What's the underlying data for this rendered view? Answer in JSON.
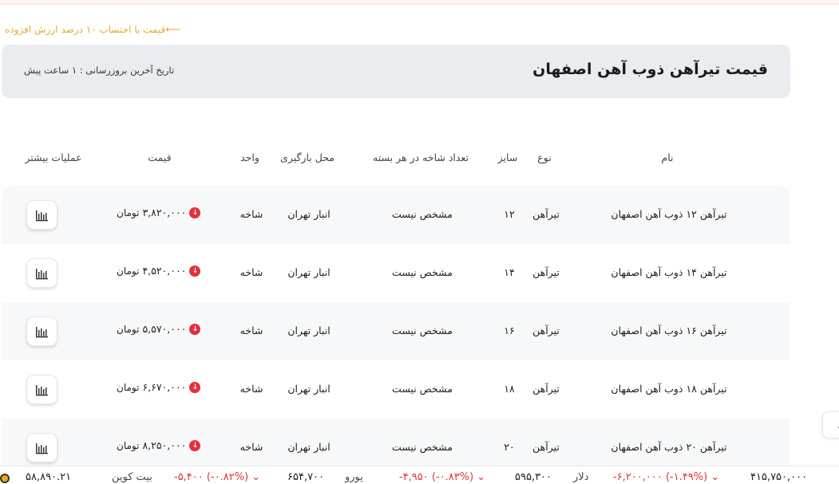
{
  "vat_link": {
    "label": "قیمت با احتساب ۱۰ درصد ارزش افزوده",
    "arrow": "⟵"
  },
  "header": {
    "title": "قیمت تیرآهن ذوب آهن اصفهان",
    "update": "تاریخ آخرین بروزرسانی : ۱ ساعت پیش"
  },
  "table": {
    "columns": {
      "name": "نام",
      "type": "نوع",
      "size": "سایز",
      "count": "تعداد شاخه در هر بسته",
      "location": "محل بارگیری",
      "unit": "واحد",
      "price": "قیمت",
      "more": "عملیات بیشتر"
    },
    "rows": [
      {
        "name": "تیرآهن ۱۲ ذوب آهن اصفهان",
        "type": "تیرآهن",
        "size": "۱۲",
        "count": "مشخص نیست",
        "location": "انبار تهران",
        "unit": "شاخه",
        "price": "۳,۸۲۰,۰۰۰",
        "currency": "تومان"
      },
      {
        "name": "تیرآهن ۱۴ ذوب آهن اصفهان",
        "type": "تیرآهن",
        "size": "۱۴",
        "count": "مشخص نیست",
        "location": "انبار تهران",
        "unit": "شاخه",
        "price": "۴,۵۲۰,۰۰۰",
        "currency": "تومان"
      },
      {
        "name": "تیرآهن ۱۶ ذوب آهن اصفهان",
        "type": "تیرآهن",
        "size": "۱۶",
        "count": "مشخص نیست",
        "location": "انبار تهران",
        "unit": "شاخه",
        "price": "۵,۵۷۰,۰۰۰",
        "currency": "تومان"
      },
      {
        "name": "تیرآهن ۱۸ ذوب آهن اصفهان",
        "type": "تیرآهن",
        "size": "۱۸",
        "count": "مشخص نیست",
        "location": "انبار تهران",
        "unit": "شاخه",
        "price": "۶,۶۷۰,۰۰۰",
        "currency": "تومان"
      },
      {
        "name": "تیرآهن ۲۰ ذوب آهن اصفهان",
        "type": "تیرآهن",
        "size": "۲۰",
        "count": "مشخص نیست",
        "location": "انبار تهران",
        "unit": "شاخه",
        "price": "۸,۲۵۰,۰۰۰",
        "currency": "تومان"
      }
    ]
  },
  "ticker": {
    "items": [
      {
        "value": "۴۱۵,۷۵۰,۰۰۰",
        "change": "-۶,۲۰۰,۰۰۰ (-۱.۴۹%) ⌄"
      },
      {
        "name": "دلار",
        "value": "۵۹۵,۳۰۰",
        "change": "-۴,۹۵۰ (-۰.۸۳%) ⌄"
      },
      {
        "name": "یورو",
        "value": "۶۵۴,۷۰۰",
        "change": "-۵,۴۰۰ (-۰.۸۲%) ⌄"
      },
      {
        "name": "بیت کوین",
        "value": "۵۸,۸۹۰.۲۱"
      }
    ]
  },
  "side_tab": {
    "label": "ی"
  },
  "colors": {
    "accent": "#e8a93a",
    "negative": "#e5303b",
    "header_bg": "#e9edf0"
  }
}
